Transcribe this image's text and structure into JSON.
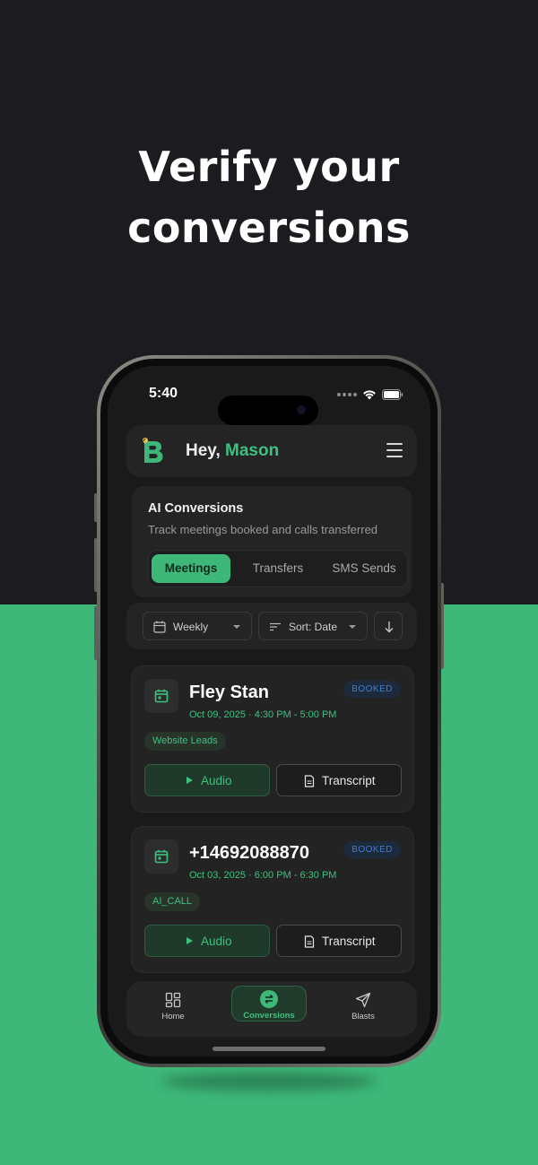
{
  "headline": {
    "line1": "Verify your",
    "line2": "conversions"
  },
  "status_bar": {
    "time": "5:40"
  },
  "header": {
    "greeting_prefix": "Hey,",
    "user_name": "Mason"
  },
  "ai_conversions": {
    "title": "AI Conversions",
    "subtitle": "Track meetings booked and calls transferred",
    "tabs": [
      {
        "label": "Meetings",
        "active": true
      },
      {
        "label": "Transfers",
        "active": false
      },
      {
        "label": "SMS Sends",
        "active": false
      }
    ]
  },
  "filters": {
    "period": "Weekly",
    "sort": "Sort: Date"
  },
  "conversions": [
    {
      "title": "Fley Stan",
      "time": "Oct 09, 2025 · 4:30 PM - 5:00 PM",
      "status": "BOOKED",
      "tag": "Website Leads",
      "audio_label": "Audio",
      "transcript_label": "Transcript"
    },
    {
      "title": "+14692088870",
      "time": "Oct 03, 2025 · 6:00 PM - 6:30 PM",
      "status": "BOOKED",
      "tag": "AI_CALL",
      "audio_label": "Audio",
      "transcript_label": "Transcript"
    }
  ],
  "bottom_nav": [
    {
      "label": "Home",
      "icon": "grid-icon",
      "active": false
    },
    {
      "label": "Conversions",
      "icon": "swap-icon",
      "active": true
    },
    {
      "label": "Blasts",
      "icon": "send-icon",
      "active": false
    }
  ],
  "colors": {
    "accent": "#3db879",
    "dark_background": "#1c1b20",
    "booked_badge": "#3f7fcf"
  }
}
